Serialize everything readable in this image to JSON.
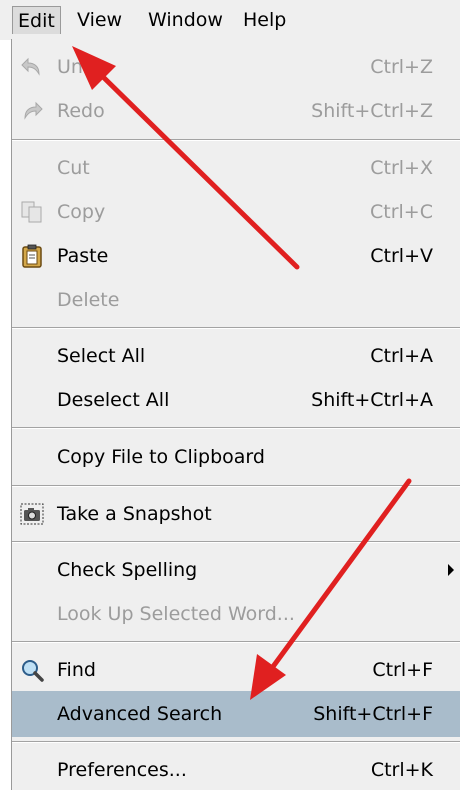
{
  "menubar": {
    "items": [
      {
        "label": "Edit"
      },
      {
        "label": "View"
      },
      {
        "label": "Window"
      },
      {
        "label": "Help"
      }
    ]
  },
  "menu": {
    "items": [
      {
        "label": "Undo",
        "shortcut": "Ctrl+Z",
        "enabled": false,
        "icon": "undo-icon"
      },
      {
        "label": "Redo",
        "shortcut": "Shift+Ctrl+Z",
        "enabled": false,
        "icon": "redo-icon"
      },
      {
        "label": "Cut",
        "shortcut": "Ctrl+X",
        "enabled": false
      },
      {
        "label": "Copy",
        "shortcut": "Ctrl+C",
        "enabled": false,
        "icon": "copy-icon"
      },
      {
        "label": "Paste",
        "shortcut": "Ctrl+V",
        "enabled": true,
        "icon": "clipboard-icon"
      },
      {
        "label": "Delete",
        "shortcut": "",
        "enabled": false
      },
      {
        "label": "Select All",
        "shortcut": "Ctrl+A",
        "enabled": true
      },
      {
        "label": "Deselect All",
        "shortcut": "Shift+Ctrl+A",
        "enabled": true
      },
      {
        "label": "Copy File to Clipboard",
        "shortcut": "",
        "enabled": true
      },
      {
        "label": "Take a Snapshot",
        "shortcut": "",
        "enabled": true,
        "icon": "camera-icon"
      },
      {
        "label": "Check Spelling",
        "shortcut": "",
        "enabled": true,
        "submenu": true
      },
      {
        "label": "Look Up Selected Word...",
        "shortcut": "",
        "enabled": false
      },
      {
        "label": "Find",
        "shortcut": "Ctrl+F",
        "enabled": true,
        "icon": "magnifier-icon"
      },
      {
        "label": "Advanced Search",
        "shortcut": "Shift+Ctrl+F",
        "enabled": true,
        "highlighted": true
      },
      {
        "label": "Preferences...",
        "shortcut": "Ctrl+K",
        "enabled": true
      }
    ]
  },
  "colors": {
    "menu_background": "#efefef",
    "highlight": "#a9bccb",
    "disabled_text": "#9c9c9c",
    "annotation_arrow": "#e02020"
  }
}
